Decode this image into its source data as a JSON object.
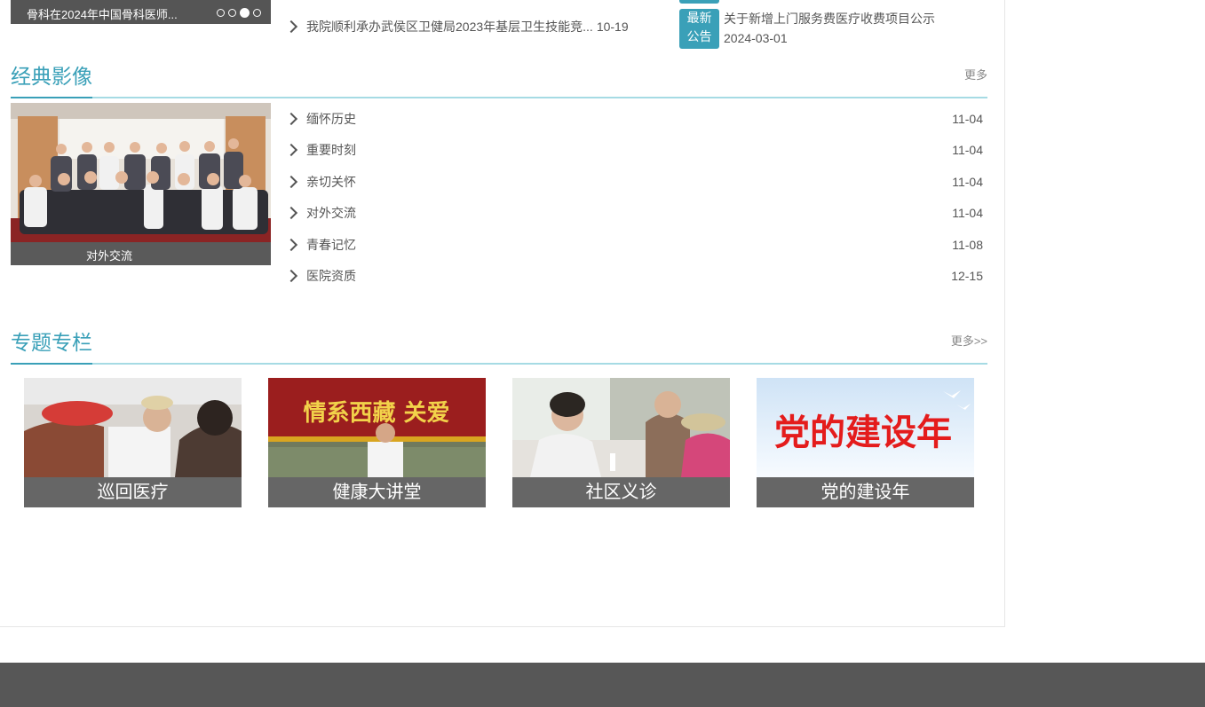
{
  "top": {
    "slide_caption": "骨科在2024年中国骨科医师...",
    "news_title": "我院顺利承办武侯区卫健局2023年基层卫生技能竞...",
    "news_date": "10-19",
    "notice_badge_line1": "最新",
    "notice_badge_line2": "公告",
    "notice_title": "关于新增上门服务费医疗收费项目公示",
    "notice_date": "2024-03-01"
  },
  "classic": {
    "title": "经典影像",
    "more": "更多",
    "photo_caption": "对外交流",
    "items": [
      {
        "title": "缅怀历史",
        "date": "11-04"
      },
      {
        "title": "重要时刻",
        "date": "11-04"
      },
      {
        "title": "亲切关怀",
        "date": "11-04"
      },
      {
        "title": "对外交流",
        "date": "11-04"
      },
      {
        "title": "青春记忆",
        "date": "11-08"
      },
      {
        "title": "医院资质",
        "date": "12-15"
      }
    ]
  },
  "special": {
    "title": "专题专栏",
    "more": "更多>>",
    "banner_text": "情系西藏 关爱",
    "party_text": "党的建设年",
    "cards": [
      {
        "label": "巡回医疗"
      },
      {
        "label": "健康大讲堂"
      },
      {
        "label": "社区义诊"
      },
      {
        "label": "党的建设年"
      }
    ]
  },
  "colors": {
    "accent": "#3aa0b8",
    "footer": "#575757",
    "caption_bg": "#666666"
  }
}
